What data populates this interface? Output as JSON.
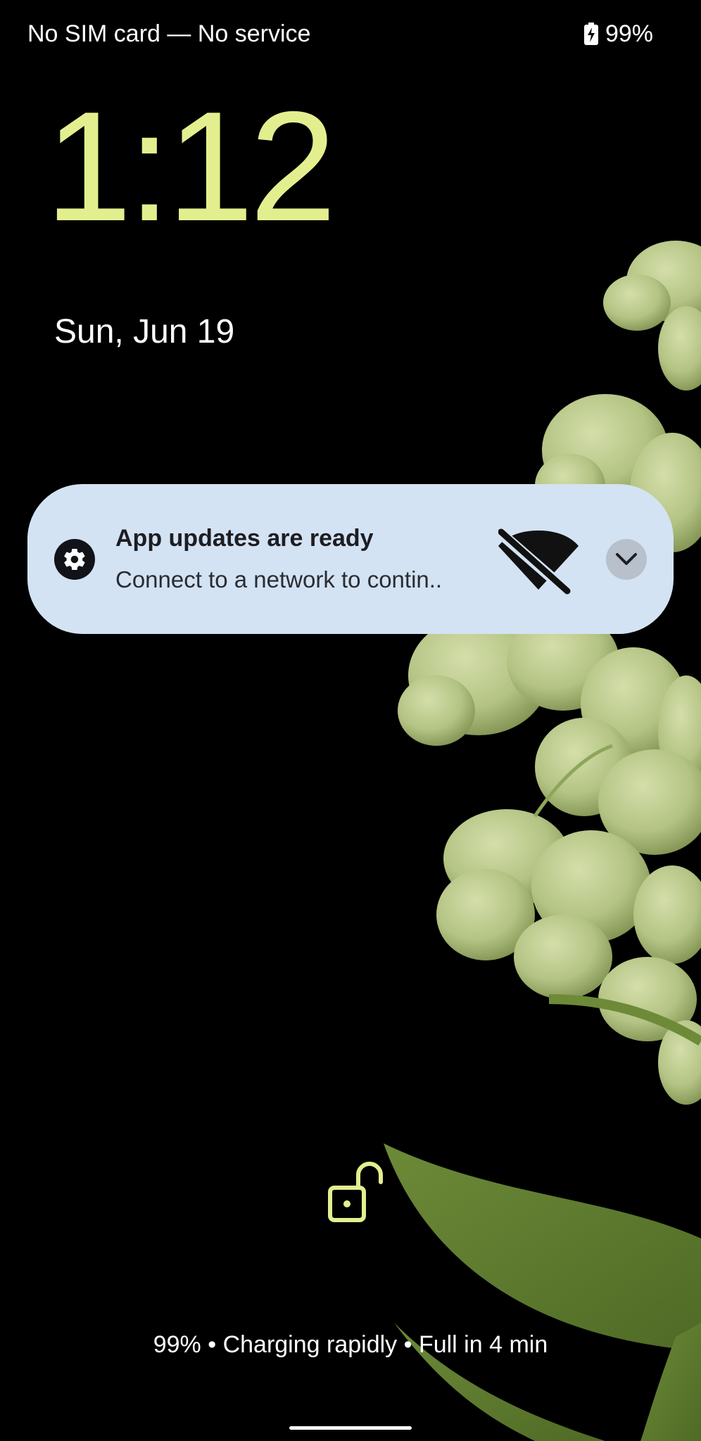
{
  "status_bar": {
    "carrier_text": "No SIM card — No service",
    "battery_percent": "99%",
    "battery_icon": "battery-charging-icon"
  },
  "lockscreen": {
    "time": "1:12",
    "date": "Sun, Jun 19",
    "lock_icon": "unlocked-padlock-icon",
    "charging_status": "99% • Charging rapidly • Full in 4 min"
  },
  "notification": {
    "app_icon": "settings-gear-icon",
    "title": "App updates are ready",
    "body": "Connect to a network to contin..",
    "large_icon": "wifi-off-icon",
    "expand_icon": "chevron-down-icon"
  },
  "colors": {
    "background": "#000000",
    "clock": "#e3ef8f",
    "notification_bg": "#d3e3f3",
    "wallpaper_flowers": "#b8c98a"
  }
}
